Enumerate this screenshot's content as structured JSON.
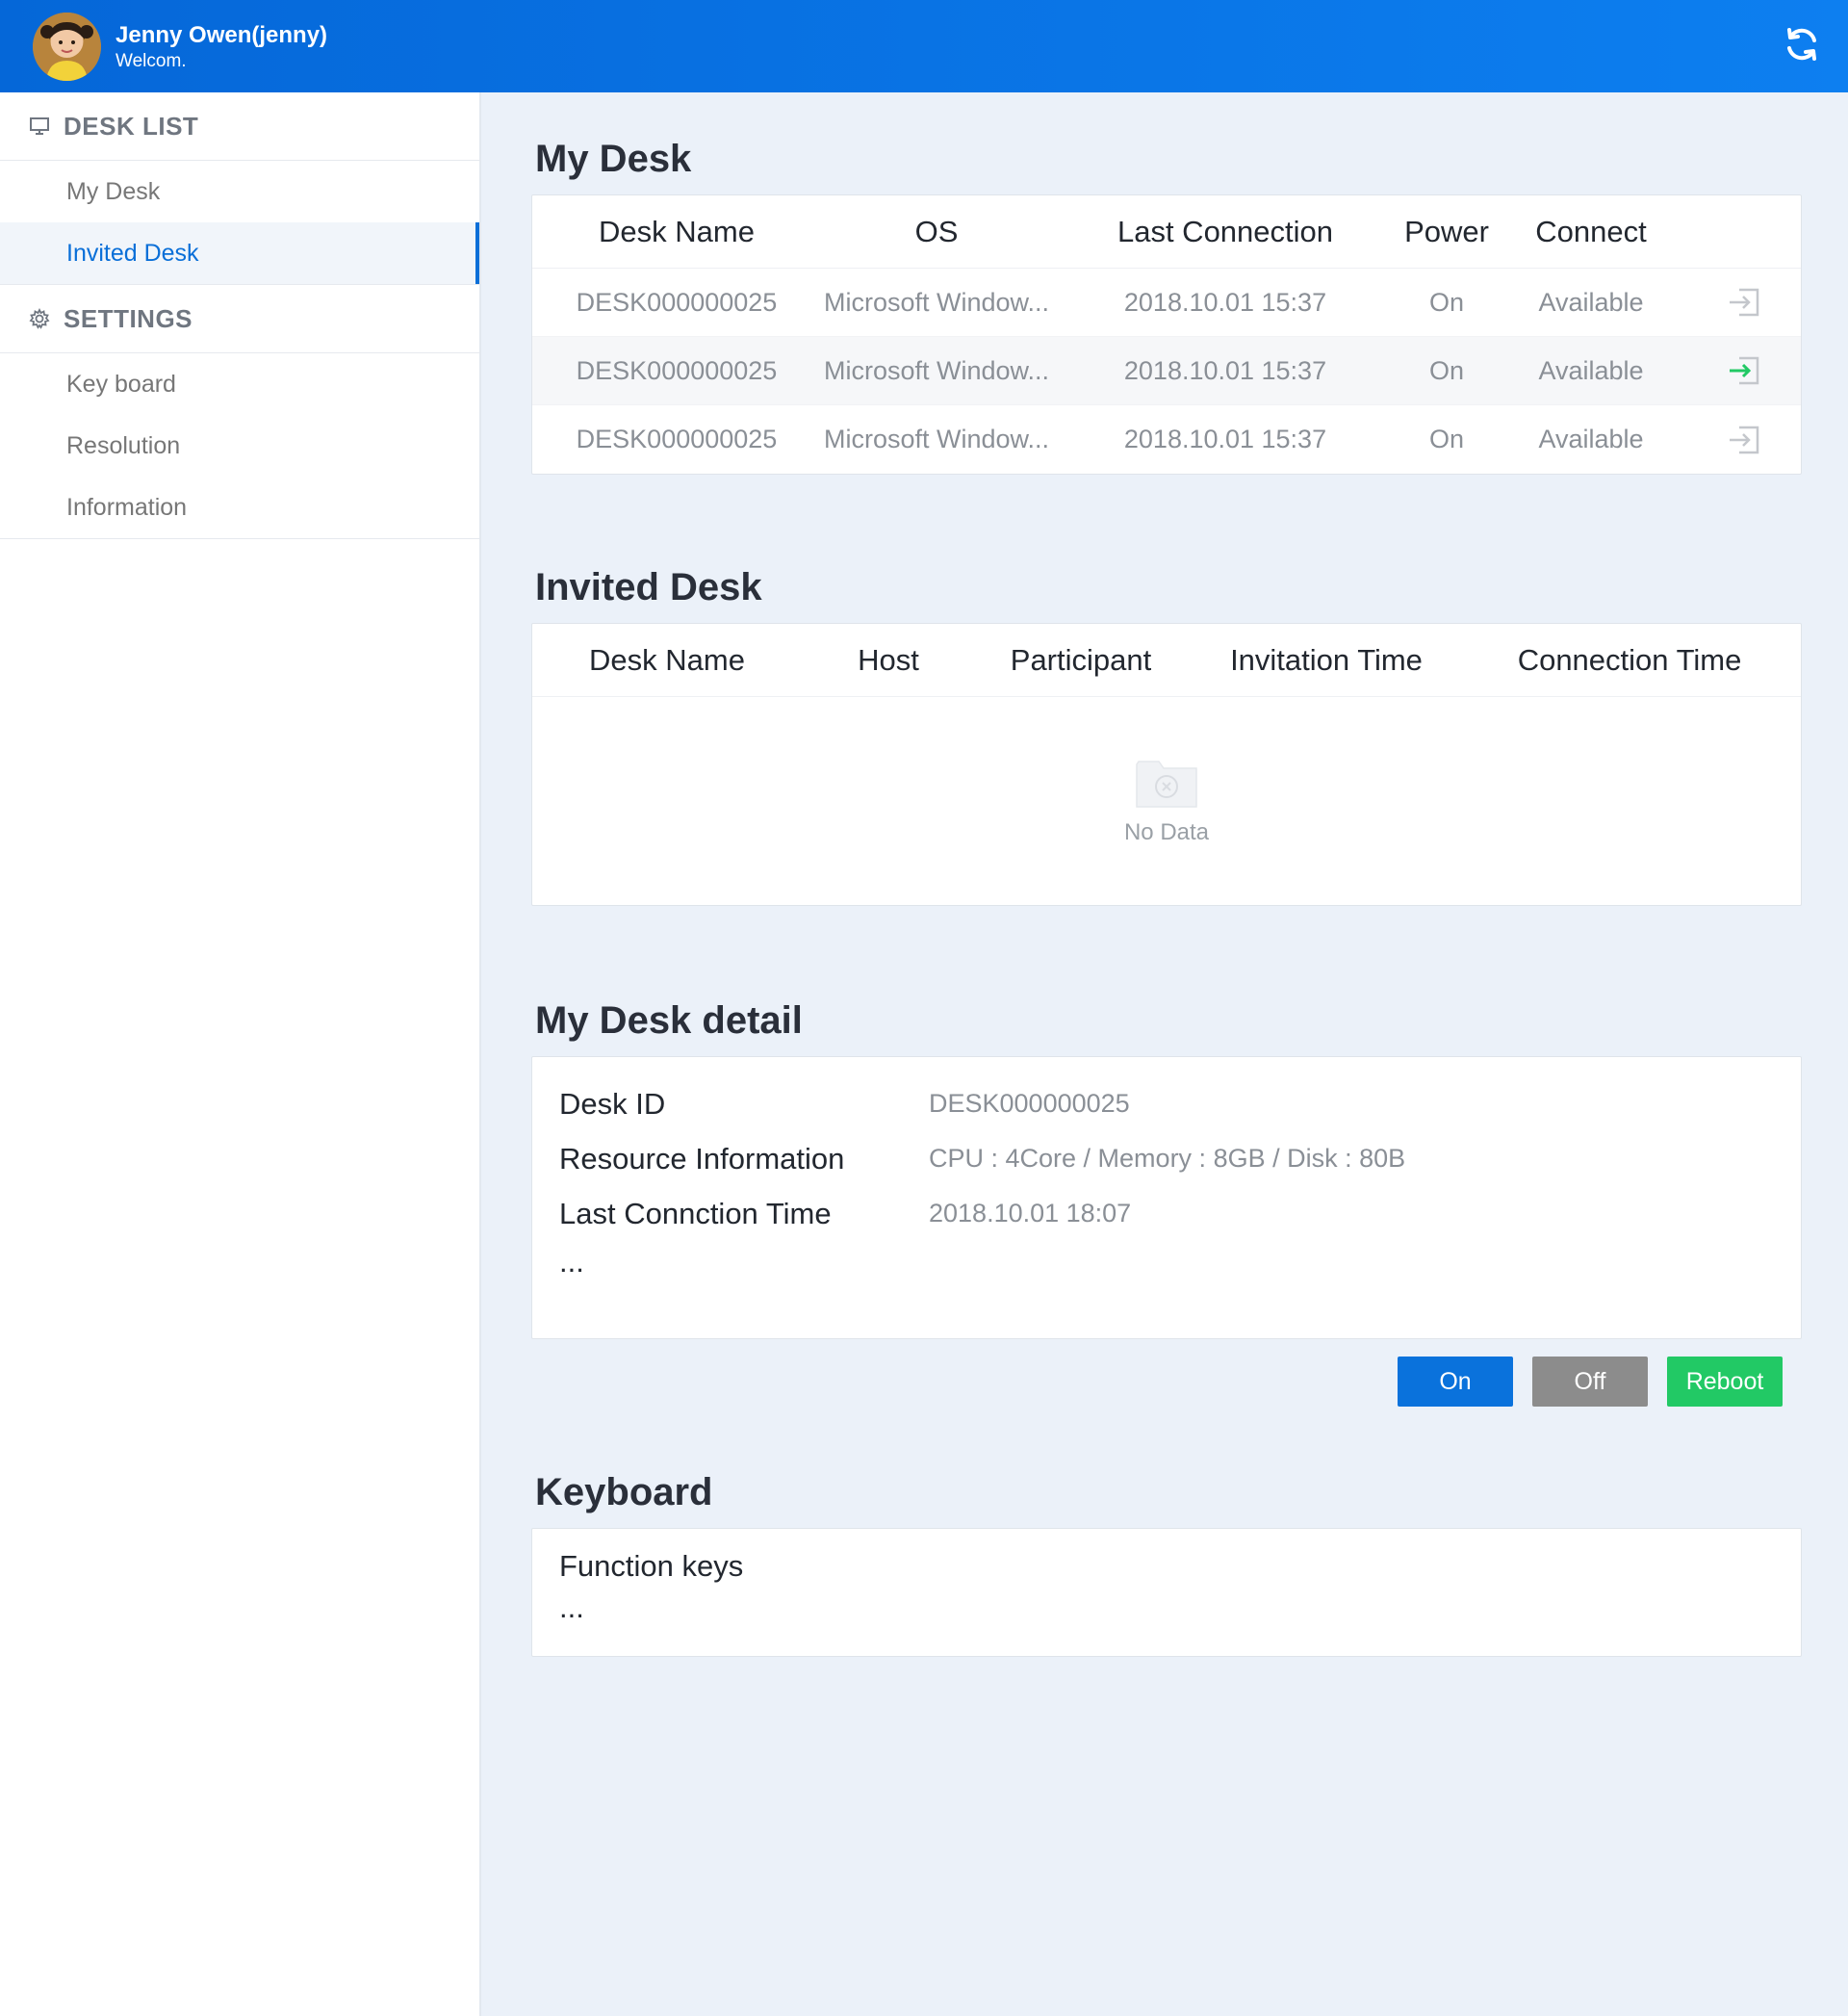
{
  "header": {
    "user_name": "Jenny Owen(jenny)",
    "greeting": "Welcom.",
    "refresh_icon": "refresh-icon",
    "colors": {
      "bar": "#0567d8"
    }
  },
  "sidebar": {
    "desk_list": {
      "title": "DESK LIST",
      "icon": "monitor-icon",
      "items": [
        {
          "label": "My Desk",
          "active": false
        },
        {
          "label": "Invited Desk",
          "active": true
        }
      ]
    },
    "settings": {
      "title": "SETTINGS",
      "icon": "gear-icon",
      "items": [
        {
          "label": "Key board"
        },
        {
          "label": "Resolution"
        },
        {
          "label": "Information"
        }
      ]
    }
  },
  "my_desk": {
    "title": "My Desk",
    "columns": [
      "Desk Name",
      "OS",
      "Last Connection",
      "Power",
      "Connect"
    ],
    "rows": [
      {
        "name": "DESK000000025",
        "os": "Microsoft Window...",
        "last": "2018.10.01 15:37",
        "power": "On",
        "connect": "Available",
        "icon": "sign-in-icon"
      },
      {
        "name": "DESK000000025",
        "os": "Microsoft Window...",
        "last": "2018.10.01 15:37",
        "power": "On",
        "connect": "Available",
        "icon": "sign-in-icon"
      },
      {
        "name": "DESK000000025",
        "os": "Microsoft Window...",
        "last": "2018.10.01 15:37",
        "power": "On",
        "connect": "Available",
        "icon": "sign-in-icon"
      }
    ]
  },
  "invited_desk": {
    "title": "Invited Desk",
    "columns": [
      "Desk Name",
      "Host",
      "Participant",
      "Invitation Time",
      "Connection Time"
    ],
    "empty_text": "No Data",
    "empty_icon": "empty-folder-icon"
  },
  "detail": {
    "title": "My Desk detail",
    "rows": [
      {
        "key": "Desk ID",
        "value": "DESK000000025"
      },
      {
        "key": "Resource Information",
        "value": "CPU : 4Core / Memory : 8GB / Disk : 80B"
      },
      {
        "key": "Last Conncti‍on Time",
        "value": "2018.10.01 18:07"
      }
    ],
    "more": "...",
    "buttons": {
      "on": "On",
      "off": "Off",
      "reboot": "Reboot"
    }
  },
  "keyboard": {
    "title": "Keyboard",
    "item": "Function keys",
    "more": "..."
  }
}
